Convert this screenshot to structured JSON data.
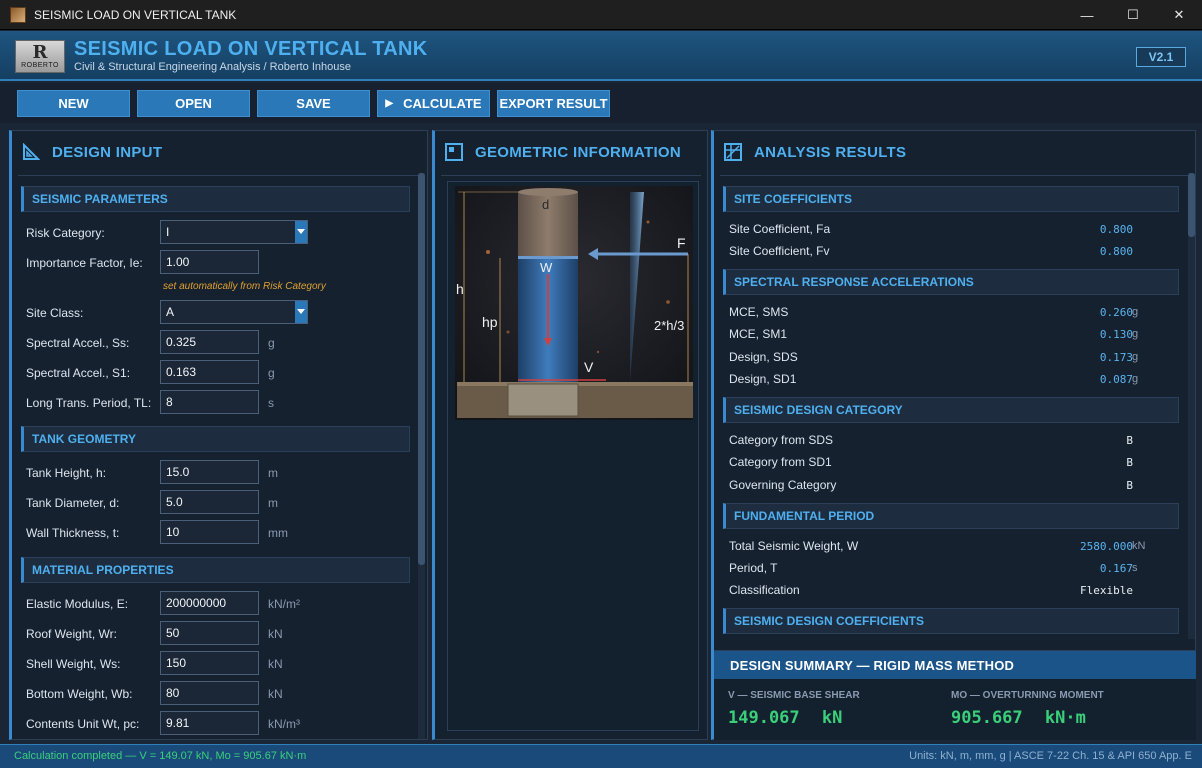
{
  "window": {
    "title": "SEISMIC LOAD ON VERTICAL TANK",
    "minimize": "—",
    "maximize": "☐",
    "close": "✕"
  },
  "header": {
    "logo_mark": "R",
    "logo_text": "ROBERTO",
    "title": "SEISMIC LOAD ON VERTICAL TANK",
    "subtitle": "Civil & Structural Engineering Analysis / Roberto Inhouse",
    "version": "V2.1"
  },
  "toolbar": {
    "new": "NEW",
    "open": "OPEN",
    "save": "SAVE",
    "calculate": "CALCULATE",
    "export": "EXPORT RESULT"
  },
  "input_panel": {
    "title": "DESIGN INPUT",
    "seismic": {
      "title": "SEISMIC PARAMETERS",
      "risk_label": "Risk Category:",
      "risk_value": "I",
      "ie_label": "Importance Factor, Ie:",
      "ie_value": "1.00",
      "ie_hint": "set automatically from Risk Category",
      "site_label": "Site Class:",
      "site_value": "A",
      "ss_label": "Spectral Accel., Ss:",
      "ss_value": "0.325",
      "ss_unit": "g",
      "s1_label": "Spectral Accel., S1:",
      "s1_value": "0.163",
      "s1_unit": "g",
      "tl_label": "Long Trans. Period, TL:",
      "tl_value": "8",
      "tl_unit": "s"
    },
    "geometry": {
      "title": "TANK GEOMETRY",
      "h_label": "Tank Height, h:",
      "h_value": "15.0",
      "h_unit": "m",
      "d_label": "Tank Diameter, d:",
      "d_value": "5.0",
      "d_unit": "m",
      "t_label": "Wall Thickness, t:",
      "t_value": "10",
      "t_unit": "mm"
    },
    "material": {
      "title": "MATERIAL PROPERTIES",
      "e_label": "Elastic Modulus, E:",
      "e_value": "200000000",
      "e_unit": "kN/m²",
      "wr_label": "Roof Weight, Wr:",
      "wr_value": "50",
      "wr_unit": "kN",
      "ws_label": "Shell Weight, Ws:",
      "ws_value": "150",
      "ws_unit": "kN",
      "wb_label": "Bottom Weight, Wb:",
      "wb_value": "80",
      "wb_unit": "kN",
      "pc_label": "Contents Unit Wt, pc:",
      "pc_value": "9.81",
      "pc_unit": "kN/m³"
    }
  },
  "geometry_panel": {
    "title": "GEOMETRIC INFORMATION",
    "diagram": {
      "d": "d",
      "h": "h",
      "hp": "hp",
      "w": "W",
      "v": "V",
      "f": "F",
      "two_h3": "2*h/3"
    }
  },
  "results_panel": {
    "title": "ANALYSIS RESULTS",
    "site": {
      "title": "SITE COEFFICIENTS",
      "fa_label": "Site Coefficient, Fa",
      "fa_value": "0.800",
      "fv_label": "Site Coefficient, Fv",
      "fv_value": "0.800"
    },
    "spectral": {
      "title": "SPECTRAL RESPONSE ACCELERATIONS",
      "sms_label": "MCE, SMS",
      "sms_value": "0.260",
      "sms_unit": "g",
      "sm1_label": "MCE, SM1",
      "sm1_value": "0.130",
      "sm1_unit": "g",
      "sds_label": "Design, SDS",
      "sds_value": "0.173",
      "sds_unit": "g",
      "sd1_label": "Design, SD1",
      "sd1_value": "0.087",
      "sd1_unit": "g"
    },
    "category": {
      "title": "SEISMIC DESIGN CATEGORY",
      "c1_label": "Category from SDS",
      "c1_value": "B",
      "c2_label": "Category from SD1",
      "c2_value": "B",
      "c3_label": "Governing Category",
      "c3_value": "B"
    },
    "period": {
      "title": "FUNDAMENTAL PERIOD",
      "w_label": "Total Seismic Weight, W",
      "w_value": "2580.000",
      "w_unit": "kN",
      "t_label": "Period, T",
      "t_value": "0.167",
      "t_unit": "s",
      "cls_label": "Classification",
      "cls_value": "Flexible"
    },
    "coeffs": {
      "title": "SEISMIC DESIGN COEFFICIENTS"
    }
  },
  "summary": {
    "title": "DESIGN SUMMARY — RIGID MASS METHOD",
    "v_key": "V — SEISMIC BASE SHEAR",
    "v_value": "149.067",
    "v_unit": "kN",
    "mo_key": "MO — OVERTURNING MOMENT",
    "mo_value": "905.667",
    "mo_unit": "kN·m"
  },
  "status": {
    "left": "Calculation completed — V = 149.07 kN,  Mo = 905.67 kN·m",
    "right": "Units: kN, m, mm, g  |  ASCE 7-22 Ch. 15 & API 650 App. E"
  },
  "colors": {
    "accent": "#4fb0f0",
    "button": "#2a78b8",
    "success": "#3ad07a",
    "hint": "#e0a030"
  }
}
